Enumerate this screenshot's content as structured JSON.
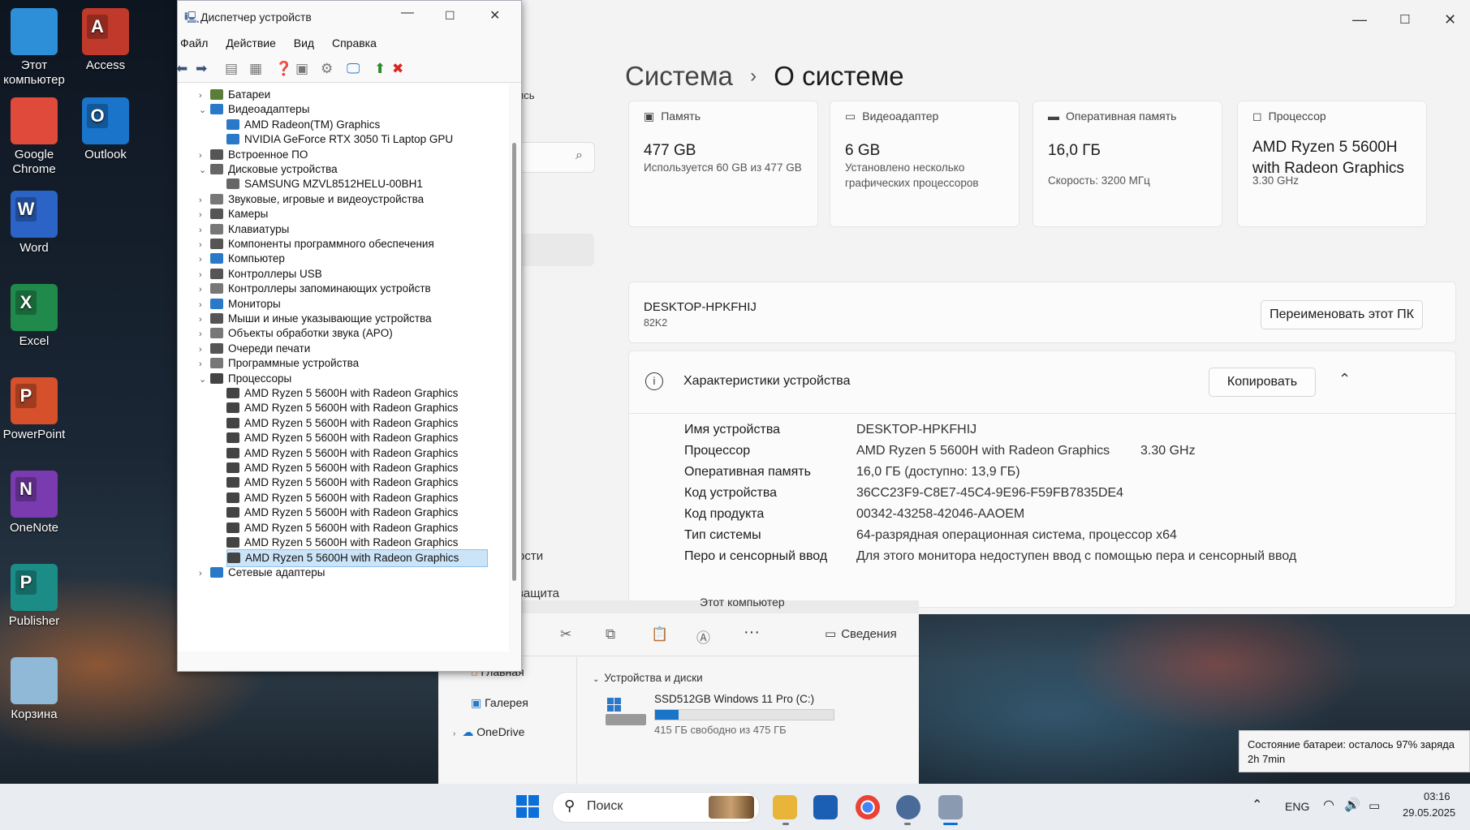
{
  "desktop": {
    "icons": [
      {
        "label": "Этот\nкомпьютер",
        "color": "#2d8fd8"
      },
      {
        "label": "Access",
        "color": "#c0392b",
        "letter": "A"
      },
      {
        "label": "Google\nChrome",
        "color": "#e04a3a"
      },
      {
        "label": "Outlook",
        "color": "#1a74c9",
        "letter": "O"
      },
      {
        "label": "Word",
        "color": "#2b63c6",
        "letter": "W"
      },
      {
        "label": "Excel",
        "color": "#1f8a4c",
        "letter": "X"
      },
      {
        "label": "PowerPoint",
        "color": "#d5502b",
        "letter": "P"
      },
      {
        "label": "OneNote",
        "color": "#7a3bb0",
        "letter": "N"
      },
      {
        "label": "Publisher",
        "color": "#1c8d86",
        "letter": "P"
      },
      {
        "label": "Корзина",
        "color": "#8fb9d6"
      }
    ]
  },
  "settings": {
    "breadcrumb_parent": "Система",
    "breadcrumb_sep": "›",
    "breadcrumb_current": "О системе",
    "sidebar_fragments": [
      "ись",
      "ости",
      "защита"
    ],
    "specs": [
      {
        "icon": "storage-icon",
        "title": "Память",
        "value": "477 GB",
        "sub": "Используется 60 GB из 477 GB"
      },
      {
        "icon": "gpu-icon",
        "title": "Видеоадаптер",
        "value": "6 GB",
        "sub": "Установлено несколько графических процессоров"
      },
      {
        "icon": "ram-icon",
        "title": "Оперативная память",
        "value": "16,0 ГБ",
        "sub": "Скорость: 3200 МГц"
      },
      {
        "icon": "cpu-icon",
        "title": "Процессор",
        "value": "AMD Ryzen 5 5600H with Radeon Graphics",
        "sub": "3.30 GHz"
      }
    ],
    "device_name": "DESKTOP-HPKFHIJ",
    "device_model": "82K2",
    "rename_button": "Переименовать этот ПК",
    "section_title": "Характеристики устройства",
    "copy_button": "Копировать",
    "rows": [
      {
        "label": "Имя устройства",
        "value": "DESKTOP-HPKFHIJ",
        "extra": ""
      },
      {
        "label": "Процессор",
        "value": "AMD Ryzen 5 5600H with Radeon Graphics",
        "extra": "3.30 GHz"
      },
      {
        "label": "Оперативная память",
        "value": "16,0 ГБ (доступно: 13,9 ГБ)",
        "extra": ""
      },
      {
        "label": "Код устройства",
        "value": "36CC23F9-C8E7-45C4-9E96-F59FB7835DE4",
        "extra": ""
      },
      {
        "label": "Код продукта",
        "value": "00342-43258-42046-AAOEM",
        "extra": ""
      },
      {
        "label": "Тип системы",
        "value": "64-разрядная операционная система, процессор x64",
        "extra": ""
      },
      {
        "label": "Перо и сенсорный ввод",
        "value": "Для этого монитора недоступен ввод с помощью пера и сенсорный ввод",
        "extra": ""
      }
    ]
  },
  "explorer": {
    "address": "Этот компьютер",
    "details_button": "Сведения",
    "nav": [
      {
        "label": "Главная"
      },
      {
        "label": "Галерея"
      },
      {
        "label": "OneDrive"
      }
    ],
    "group_title": "Устройства и диски",
    "drive_name": "SSD512GB Windows 11 Pro (C:)",
    "drive_free": "415 ГБ свободно из 475 ГБ",
    "drive_used_fraction": 0.13
  },
  "device_manager": {
    "title": "Диспетчер устройств",
    "menu": [
      "Файл",
      "Действие",
      "Вид",
      "Справка"
    ],
    "tree": [
      {
        "label": "Батареи",
        "level": 0,
        "expanded": false,
        "color": "#5a7d3a"
      },
      {
        "label": "Видеоадаптеры",
        "level": 0,
        "expanded": true,
        "color": "#2a78c8"
      },
      {
        "label": "AMD Radeon(TM) Graphics",
        "level": 1,
        "color": "#2a78c8"
      },
      {
        "label": "NVIDIA GeForce RTX 3050 Ti Laptop GPU",
        "level": 1,
        "color": "#2a78c8"
      },
      {
        "label": "Встроенное ПО",
        "level": 0,
        "expanded": false,
        "color": "#555"
      },
      {
        "label": "Дисковые устройства",
        "level": 0,
        "expanded": true,
        "color": "#666"
      },
      {
        "label": "SAMSUNG MZVL8512HELU-00BH1",
        "level": 1,
        "color": "#666"
      },
      {
        "label": "Звуковые, игровые и видеоустройства",
        "level": 0,
        "expanded": false,
        "color": "#777"
      },
      {
        "label": "Камеры",
        "level": 0,
        "expanded": false,
        "color": "#555"
      },
      {
        "label": "Клавиатуры",
        "level": 0,
        "expanded": false,
        "color": "#777"
      },
      {
        "label": "Компоненты программного обеспечения",
        "level": 0,
        "expanded": false,
        "color": "#555"
      },
      {
        "label": "Компьютер",
        "level": 0,
        "expanded": false,
        "color": "#2a78c8"
      },
      {
        "label": "Контроллеры USB",
        "level": 0,
        "expanded": false,
        "color": "#555"
      },
      {
        "label": "Контроллеры запоминающих устройств",
        "level": 0,
        "expanded": false,
        "color": "#777"
      },
      {
        "label": "Мониторы",
        "level": 0,
        "expanded": false,
        "color": "#2a78c8"
      },
      {
        "label": "Мыши и иные указывающие устройства",
        "level": 0,
        "expanded": false,
        "color": "#555"
      },
      {
        "label": "Объекты обработки звука (APO)",
        "level": 0,
        "expanded": false,
        "color": "#777"
      },
      {
        "label": "Очереди печати",
        "level": 0,
        "expanded": false,
        "color": "#555"
      },
      {
        "label": "Программные устройства",
        "level": 0,
        "expanded": false,
        "color": "#777"
      },
      {
        "label": "Процессоры",
        "level": 0,
        "expanded": true,
        "color": "#444"
      },
      {
        "label": "AMD Ryzen 5 5600H with Radeon Graphics",
        "level": 1,
        "color": "#444"
      },
      {
        "label": "AMD Ryzen 5 5600H with Radeon Graphics",
        "level": 1,
        "color": "#444"
      },
      {
        "label": "AMD Ryzen 5 5600H with Radeon Graphics",
        "level": 1,
        "color": "#444"
      },
      {
        "label": "AMD Ryzen 5 5600H with Radeon Graphics",
        "level": 1,
        "color": "#444"
      },
      {
        "label": "AMD Ryzen 5 5600H with Radeon Graphics",
        "level": 1,
        "color": "#444"
      },
      {
        "label": "AMD Ryzen 5 5600H with Radeon Graphics",
        "level": 1,
        "color": "#444"
      },
      {
        "label": "AMD Ryzen 5 5600H with Radeon Graphics",
        "level": 1,
        "color": "#444"
      },
      {
        "label": "AMD Ryzen 5 5600H with Radeon Graphics",
        "level": 1,
        "color": "#444"
      },
      {
        "label": "AMD Ryzen 5 5600H with Radeon Graphics",
        "level": 1,
        "color": "#444"
      },
      {
        "label": "AMD Ryzen 5 5600H with Radeon Graphics",
        "level": 1,
        "color": "#444"
      },
      {
        "label": "AMD Ryzen 5 5600H with Radeon Graphics",
        "level": 1,
        "color": "#444"
      },
      {
        "label": "AMD Ryzen 5 5600H with Radeon Graphics",
        "level": 1,
        "color": "#444",
        "selected": true
      },
      {
        "label": "Сетевые адаптеры",
        "level": 0,
        "expanded": false,
        "color": "#2a78c8"
      }
    ]
  },
  "taskbar": {
    "search_placeholder": "Поиск",
    "lang": "ENG",
    "time": "03:16",
    "date": "29.05.2025"
  },
  "battery_tooltip": {
    "line1": "Состояние батареи: осталось 97% заряда",
    "line2": "2h 7min"
  }
}
